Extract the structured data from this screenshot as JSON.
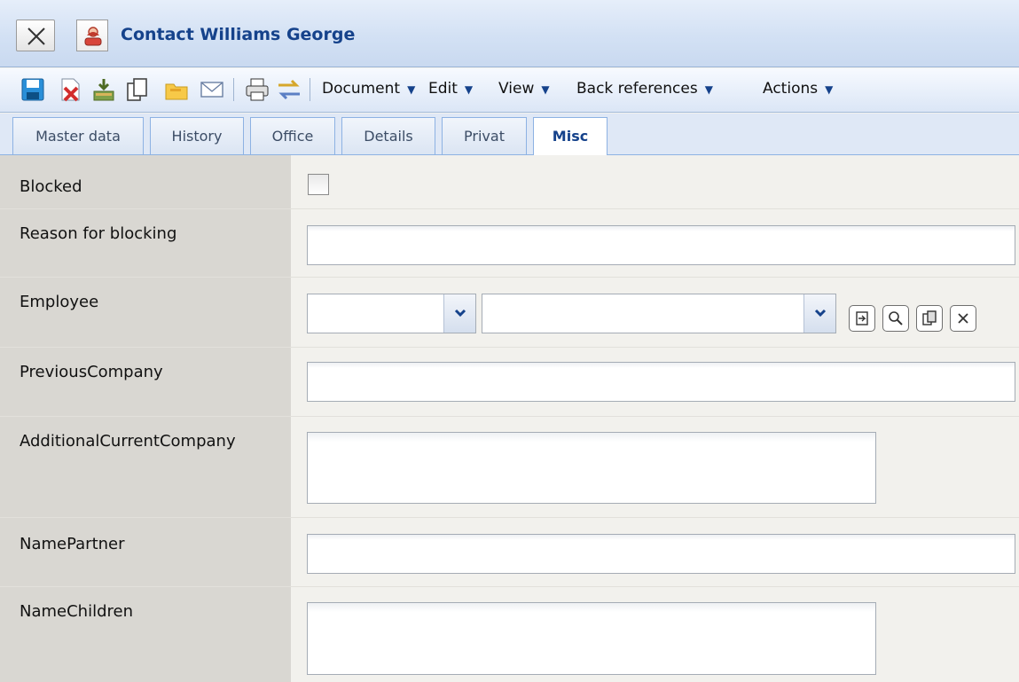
{
  "window": {
    "title": "Contact Williams George",
    "close_icon": "close-x-icon",
    "entity_icon": "contact-person-icon"
  },
  "toolbar": {
    "icons": [
      "save-icon",
      "delete-document-icon",
      "import-icon",
      "copy-icon",
      "open-folder-icon",
      "email-icon",
      "print-icon",
      "switch-icon"
    ],
    "menus": [
      {
        "label": "Document"
      },
      {
        "label": "Edit"
      },
      {
        "label": "View"
      },
      {
        "label": "Back references"
      },
      {
        "label": "Actions"
      }
    ]
  },
  "tabs": [
    {
      "label": "Master data",
      "active": false
    },
    {
      "label": "History",
      "active": false
    },
    {
      "label": "Office",
      "active": false
    },
    {
      "label": "Details",
      "active": false
    },
    {
      "label": "Privat",
      "active": false
    },
    {
      "label": "Misc",
      "active": true
    }
  ],
  "form": {
    "blocked": {
      "label": "Blocked",
      "checked": false
    },
    "reason_for_blocking": {
      "label": "Reason for blocking",
      "value": ""
    },
    "employee": {
      "label": "Employee",
      "value_short": "",
      "value_long": "",
      "actions": [
        "goto-icon",
        "search-icon",
        "copy-icon",
        "clear-icon"
      ]
    },
    "previous_company": {
      "label": "PreviousCompany",
      "value": ""
    },
    "additional_current_company": {
      "label": "AdditionalCurrentCompany",
      "value": ""
    },
    "name_partner": {
      "label": "NamePartner",
      "value": ""
    },
    "name_children": {
      "label": "NameChildren",
      "value": ""
    }
  },
  "colors": {
    "title": "#15428b",
    "label_column": "#d9d7d2",
    "form_background": "#f2f1ed"
  }
}
